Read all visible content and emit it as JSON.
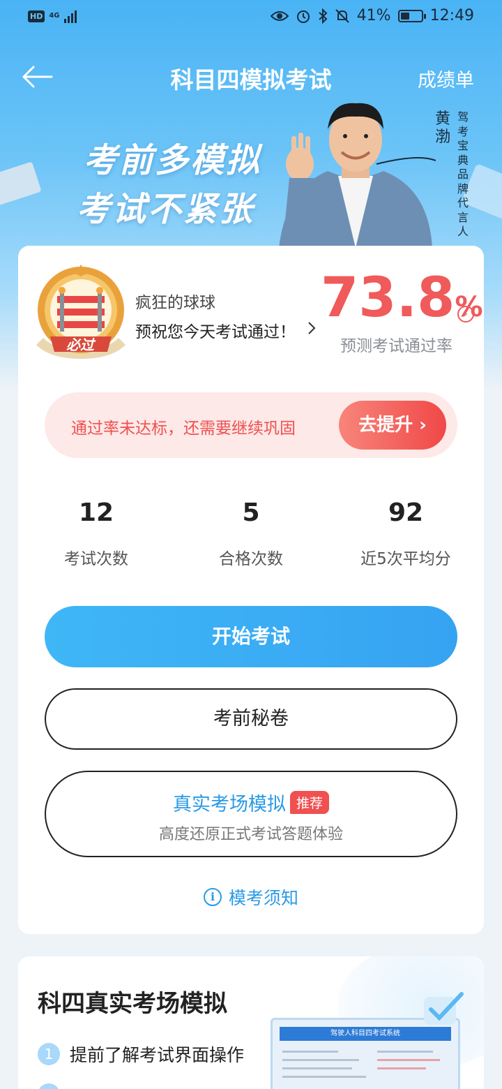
{
  "status_bar": {
    "hd": "HD",
    "network": "4G",
    "battery": "41%",
    "time": "12:49"
  },
  "nav": {
    "title": "科目四模拟考试",
    "right_label": "成绩单"
  },
  "banner": {
    "slogan_line1": "考前多模拟",
    "slogan_line2": "考试不紧张",
    "spokesperson_name": "黄渤",
    "spokesperson_title": "驾考宝典品牌代言人"
  },
  "profile": {
    "badge_text": "必过",
    "user_name": "疯狂的球球",
    "wish": "预祝您今天考试通过！",
    "pass_rate_value": "73.8",
    "pass_rate_unit": "%",
    "pass_rate_label": "预测考试通过率"
  },
  "warning": {
    "text": "通过率未达标，还需要继续巩固",
    "button": "去提升"
  },
  "stats": [
    {
      "value": "12",
      "label": "考试次数"
    },
    {
      "value": "5",
      "label": "合格次数"
    },
    {
      "value": "92",
      "label": "近5次平均分"
    }
  ],
  "buttons": {
    "start": "开始考试",
    "secret": "考前秘卷",
    "real_title": "真实考场模拟",
    "real_tag": "推荐",
    "real_sub": "高度还原正式考试答题体验"
  },
  "notice": "模考须知",
  "real_section": {
    "title": "科四真实考场模拟",
    "features": [
      {
        "num": "1",
        "text": "提前了解考试界面操作"
      }
    ],
    "screen_title": "驾驶人科目四考试系统"
  },
  "colors": {
    "primary_blue": "#36a3f2",
    "warning_red": "#f05a5a",
    "link_blue": "#2a9ae6"
  }
}
